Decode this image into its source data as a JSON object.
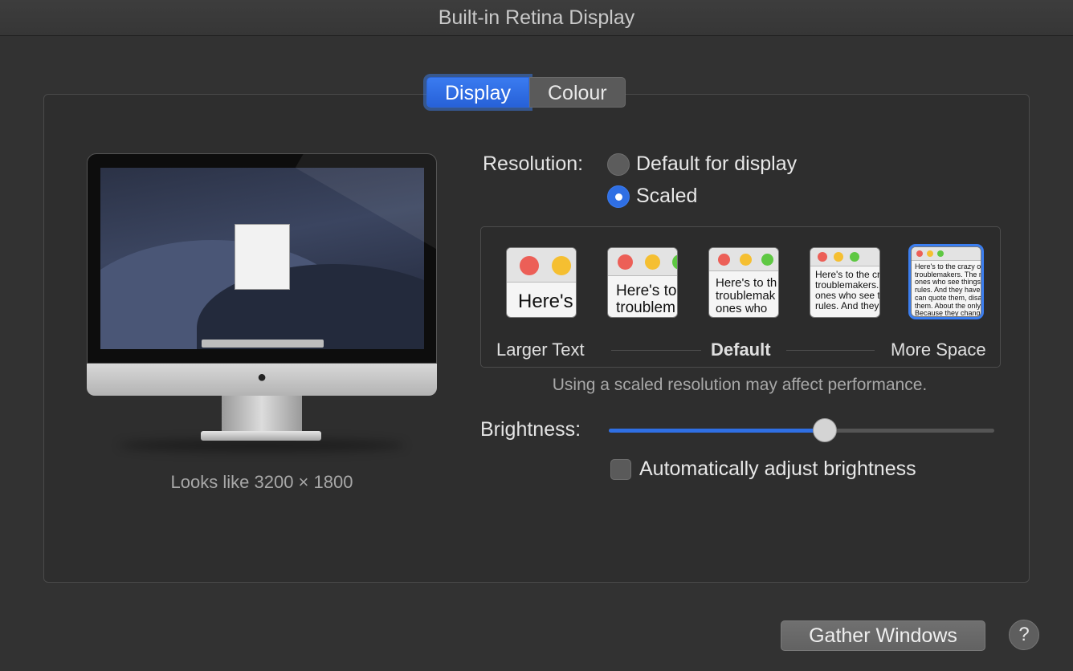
{
  "window": {
    "title": "Built-in Retina Display"
  },
  "tabs": [
    {
      "label": "Display",
      "selected": true
    },
    {
      "label": "Colour",
      "selected": false
    }
  ],
  "preview": {
    "looks_like": "Looks like 3200 × 1800"
  },
  "resolution": {
    "label": "Resolution:",
    "options": [
      {
        "label": "Default for display",
        "selected": false
      },
      {
        "label": "Scaled",
        "selected": true
      }
    ]
  },
  "scaling": {
    "thumbnails": [
      {
        "text": "Here's",
        "selected": false
      },
      {
        "text": "Here's to\ntroublem",
        "selected": false
      },
      {
        "text": "Here's to th\ntroublemak\nones who",
        "selected": false
      },
      {
        "text": "Here's to the cr\ntroublemakers.\nones who see t\nrules. And they",
        "selected": false
      },
      {
        "text": "Here's to the crazy one\ntroublemakers. The rou\nones who see things di\nrules. And they have no\ncan quote them, disagr\nthem. About the only t\nBecause they change th",
        "selected": true
      }
    ],
    "label_left": "Larger Text",
    "label_center": "Default",
    "label_right": "More Space",
    "note": "Using a scaled resolution may affect performance."
  },
  "brightness": {
    "label": "Brightness:",
    "value_fraction": 0.56
  },
  "auto_brightness": {
    "label": "Automatically adjust brightness",
    "checked": false
  },
  "buttons": {
    "gather_windows": "Gather Windows",
    "help": "?"
  },
  "colors": {
    "accent": "#2f6fe4",
    "background": "#323232"
  }
}
